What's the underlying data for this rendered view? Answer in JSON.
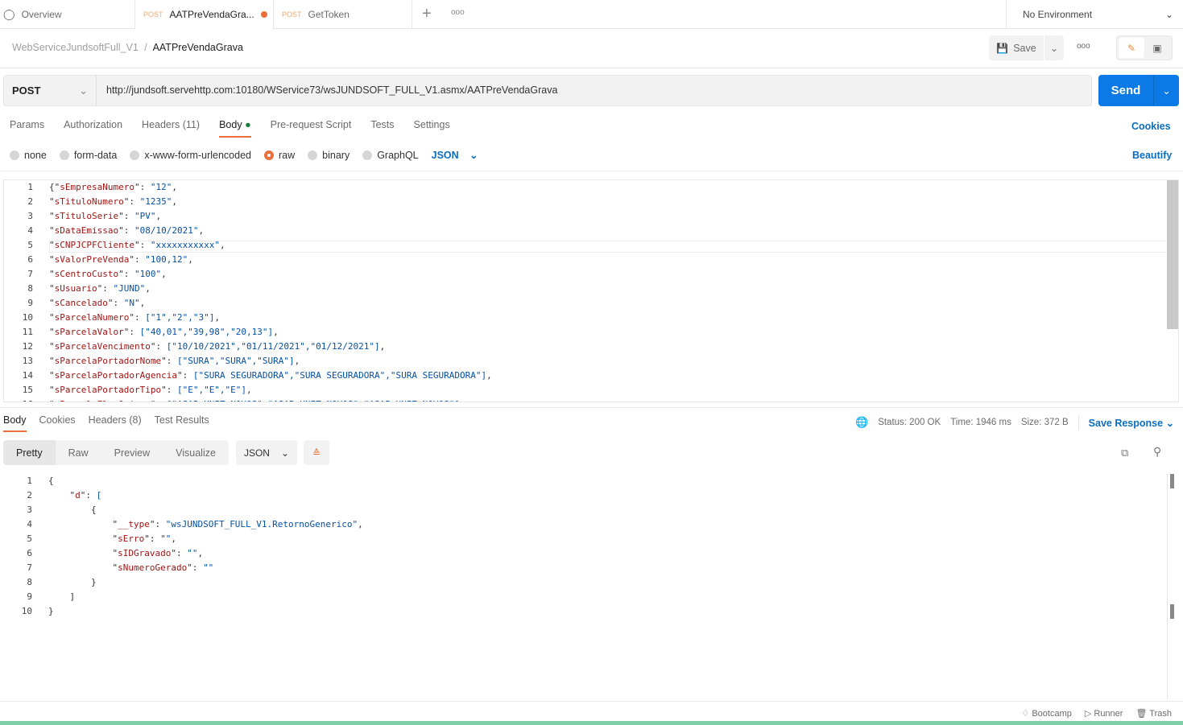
{
  "tabs": {
    "overview": "Overview",
    "items": [
      {
        "method": "POST",
        "label": "AATPreVendaGra...",
        "unsaved": true
      },
      {
        "method": "POST",
        "label": "GetToken",
        "unsaved": false
      }
    ],
    "environment": "No Environment"
  },
  "breadcrumb": {
    "collection": "WebServiceJundsoftFull_V1",
    "separator": "/",
    "request": "AATPreVendaGrava"
  },
  "toolbar": {
    "save": "Save"
  },
  "request": {
    "method": "POST",
    "url": "http://jundsoft.servehttp.com:10180/WService73/wsJUNDSOFT_FULL_V1.asmx/AATPreVendaGrava",
    "send": "Send"
  },
  "req_tabs": [
    "Params",
    "Authorization",
    "Headers (11)",
    "Body",
    "Pre-request Script",
    "Tests",
    "Settings"
  ],
  "cookies": "Cookies",
  "body_types": [
    "none",
    "form-data",
    "x-www-form-urlencoded",
    "raw",
    "binary",
    "GraphQL"
  ],
  "body_format": "JSON",
  "beautify": "Beautify",
  "body_lines": [
    [
      "{\"",
      "sEmpresaNumero",
      "\": ",
      "\"12\"",
      ","
    ],
    [
      "\"",
      "sTituloNumero",
      "\": ",
      "\"1235\"",
      ","
    ],
    [
      "\"",
      "sTituloSerie",
      "\": ",
      "\"PV\"",
      ","
    ],
    [
      "\"",
      "sDataEmissao",
      "\": ",
      "\"08/10/2021\"",
      ","
    ],
    [
      "\"",
      "sCNPJCPFCliente",
      "\": ",
      "\"xxxxxxxxxxx\"",
      ","
    ],
    [
      "\"",
      "sValorPreVenda",
      "\": ",
      "\"100,12\"",
      ","
    ],
    [
      "\"",
      "sCentroCusto",
      "\": ",
      "\"100\"",
      ","
    ],
    [
      "\"",
      "sUsuario",
      "\": ",
      "\"JUND\"",
      ","
    ],
    [
      "\"",
      "sCancelado",
      "\": ",
      "\"N\"",
      ","
    ],
    [
      "\"",
      "sParcelaNumero",
      "\": ",
      "[\"1\",\"2\",\"3\"]",
      ","
    ],
    [
      "\"",
      "sParcelaValor",
      "\": ",
      "[\"40,01\",\"39,98\",\"20,13\"]",
      ","
    ],
    [
      "\"",
      "sParcelaVencimento",
      "\": ",
      "[\"10/10/2021\",\"01/11/2021\",\"01/12/2021\"]",
      ","
    ],
    [
      "\"",
      "sParcelaPortadorNome",
      "\": ",
      "[\"SURA\",\"SURA\",\"SURA\"]",
      ","
    ],
    [
      "\"",
      "sParcelaPortadorAgencia",
      "\": ",
      "[\"SURA SEGURADORA\",\"SURA SEGURADORA\",\"SURA SEGURADORA\"]",
      ","
    ],
    [
      "\"",
      "sParcelaPortadorTipo",
      "\": ",
      "[\"E\",\"E\",\"E\"]",
      ","
    ],
    [
      "\"",
      "sParcelaFlagOrigem",
      "\": ",
      "[\"ASAP UNIT NOVOS\",\"ASAP UNIT NOVOS\",\"ASAP UNIT NOVOS\"]",
      ","
    ]
  ],
  "resp_tabs": [
    "Body",
    "Cookies",
    "Headers (8)",
    "Test Results"
  ],
  "status": {
    "status": "Status: 200 OK",
    "time": "Time: 1946 ms",
    "size": "Size: 372 B",
    "save_response": "Save Response"
  },
  "views": [
    "Pretty",
    "Raw",
    "Preview",
    "Visualize"
  ],
  "resp_format": "JSON",
  "resp_lines": [
    [
      "",
      "{",
      "",
      "",
      ""
    ],
    [
      "    \"",
      "d",
      "\": ",
      "[",
      ""
    ],
    [
      "        ",
      "{",
      "",
      "",
      ""
    ],
    [
      "            \"",
      "__type",
      "\": ",
      "\"wsJUNDSOFT_FULL_V1.RetornoGenerico\"",
      ","
    ],
    [
      "            \"",
      "sErro",
      "\": ",
      "\"\"",
      ","
    ],
    [
      "            \"",
      "sIDGravado",
      "\": ",
      "\"\"",
      ","
    ],
    [
      "            \"",
      "sNumeroGerado",
      "\": ",
      "\"\"",
      ""
    ],
    [
      "        ",
      "}",
      "",
      "",
      ""
    ],
    [
      "    ",
      "]",
      "",
      "",
      ""
    ],
    [
      "",
      "}",
      "",
      "",
      ""
    ]
  ],
  "footer": [
    "Bootcamp",
    "Runner",
    "Trash"
  ],
  "colors": {
    "accent": "#e8703a",
    "send": "#0b7ae6",
    "link": "#0b6ec2",
    "key": "#a31515",
    "value": "#0451a5"
  }
}
